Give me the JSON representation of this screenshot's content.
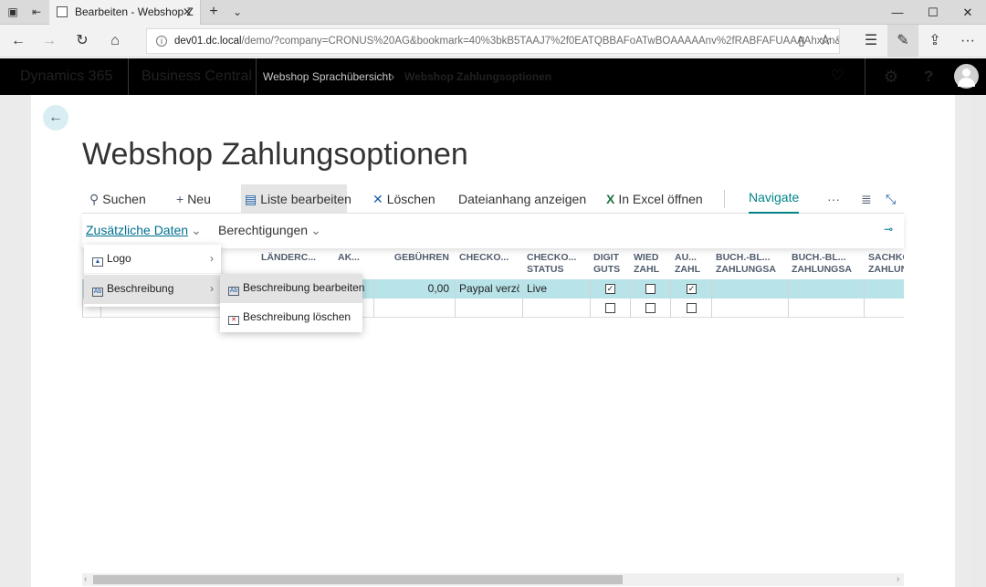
{
  "browser": {
    "tab_title": "Bearbeiten - Webshop Z",
    "url_host": "dev01.dc.local",
    "url_path": "/demo/?company=CRONUS%20AG&bookmark=40%3bkB5TAAJ7%2f0EATQBBAFoATwBOAAAAAnv%2fRABFAFUAAAAhxAn&pa"
  },
  "header": {
    "product": "Dynamics 365",
    "app": "Business Central",
    "breadcrumb_parent": "Webshop Sprachübersicht",
    "breadcrumb_current": "Webshop Zahlungsoptionen"
  },
  "page": {
    "title": "Webshop Zahlungsoptionen"
  },
  "actions": {
    "search": "Suchen",
    "new": "Neu",
    "edit_list": "Liste bearbeiten",
    "delete": "Löschen",
    "attachment": "Dateianhang anzeigen",
    "excel": "In Excel öffnen",
    "navigate": "Navigate",
    "more": "···"
  },
  "subactions": {
    "extra_data": "Zusätzliche Daten",
    "permissions": "Berechtigungen"
  },
  "grid": {
    "columns": [
      {
        "l1": "",
        "l2": "LÄNDERC..."
      },
      {
        "l1": "",
        "l2": "AK..."
      },
      {
        "l1": "",
        "l2": "GEBÜHREN"
      },
      {
        "l1": "",
        "l2": "CHECKO..."
      },
      {
        "l1": "CHECKO...",
        "l2": "STATUS"
      },
      {
        "l1": "DIGIT",
        "l2": "GUTS"
      },
      {
        "l1": "WIED",
        "l2": "ZAHL"
      },
      {
        "l1": "AU...",
        "l2": "ZAHL"
      },
      {
        "l1": "BUCH.-BL...",
        "l2": "ZAHLUNGSA"
      },
      {
        "l1": "BUCH.-BL...",
        "l2": "ZAHLUNGSA"
      },
      {
        "l1": "SACHKO",
        "l2": "ZAHLUN"
      }
    ],
    "row1": {
      "fee": "0,00",
      "checkout": "Paypal verzö",
      "status": "Live",
      "digit": true,
      "wied": false,
      "au": true
    }
  },
  "menu": {
    "logo": "Logo",
    "description": "Beschreibung",
    "edit_description": "Beschreibung bearbeiten",
    "delete_description": "Beschreibung löschen"
  },
  "colors": {
    "accent": "#008489",
    "link": "#00708f",
    "row_selected": "#b8e3e8",
    "header_bg": "#000000"
  }
}
